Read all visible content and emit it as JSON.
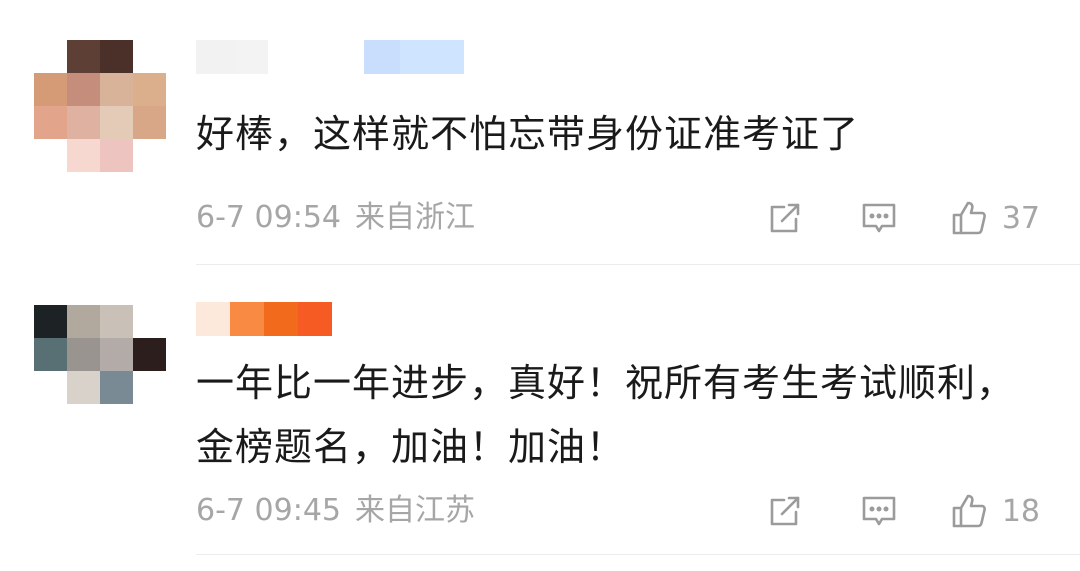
{
  "comments": [
    {
      "text": "好棒，这样就不怕忘带身份证准考证了",
      "time": "6-7 09:54",
      "location": "来自浙江",
      "likes": "37",
      "avatar_colors": [
        "#ffffff",
        "#5e3f36",
        "#4a3028",
        "#ffffff",
        "#d59a76",
        "#c58d7c",
        "#d9b29a",
        "#dcaf8c",
        "#e2a58b",
        "#dfb1a1",
        "#e3cbb8",
        "#d7a788",
        "#ffffff",
        "#f6d8d0",
        "#eec4c0",
        "#ffffff"
      ],
      "username_colors": [
        "#f2f2f2",
        "#f3f3f3",
        "#ffffff",
        "#ffffff",
        "#ffffff",
        "#c9defc",
        "#cfe4ff"
      ]
    },
    {
      "text": "一年比一年进步，真好！祝所有考生考试顺利，金榜题名，加油！加油！",
      "time": "6-7 09:45",
      "location": "来自江苏",
      "likes": "18",
      "avatar_colors": [
        "#1d2224",
        "#b1a89e",
        "#c9c0b7",
        "#ffffff",
        "#587074",
        "#9a9490",
        "#b3aba8",
        "#2b1e1c",
        "#ffffff",
        "#d8d2cb",
        "#798a94",
        "#ffffff",
        "#ffffff",
        "#ffffff",
        "#ffffff",
        "#ffffff"
      ],
      "username_colors": [
        "#fde8dc",
        "#f88a43",
        "#f26a1b",
        "#f55b22"
      ]
    }
  ],
  "icons": {
    "share": "share-icon",
    "reply": "comment-icon",
    "like": "thumbs-up-icon"
  }
}
